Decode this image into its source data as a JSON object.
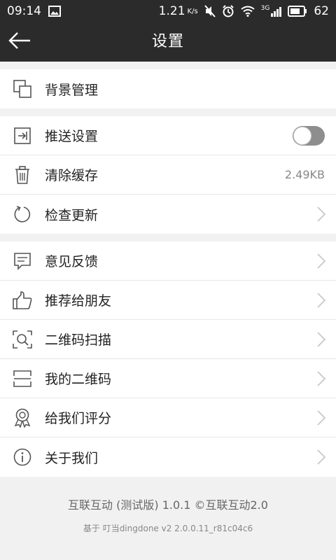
{
  "status_bar": {
    "time": "09:14",
    "speed": "1.21",
    "speed_unit": "K/s",
    "network": "3G",
    "battery": "62"
  },
  "app_bar": {
    "title": "设置",
    "back_icon": "arrow-left-icon"
  },
  "groups": [
    {
      "items": [
        {
          "label": "背景管理",
          "icon": "background-icon"
        }
      ]
    },
    {
      "items": [
        {
          "label": "推送设置",
          "icon": "push-icon",
          "toggle": "off"
        },
        {
          "label": "清除缓存",
          "icon": "trash-icon",
          "value": "2.49KB"
        },
        {
          "label": "检查更新",
          "icon": "refresh-icon"
        }
      ]
    },
    {
      "items": [
        {
          "label": "意见反馈",
          "icon": "feedback-icon"
        },
        {
          "label": "推荐给朋友",
          "icon": "thumbs-up-icon"
        },
        {
          "label": "二维码扫描",
          "icon": "scan-icon"
        },
        {
          "label": "我的二维码",
          "icon": "qrcode-icon"
        },
        {
          "label": "给我们评分",
          "icon": "award-icon"
        },
        {
          "label": "关于我们",
          "icon": "info-icon"
        }
      ]
    }
  ],
  "footer": {
    "line1": "互联互动 (测试版) 1.0.1 ©互联互动2.0",
    "line2": "基于 叮当dingdone v2 2.0.0.11_r81c04c6"
  },
  "colors": {
    "bar": "#2b2b2b",
    "toggle_off": "#8e8e8e",
    "background": "#f1f1f1"
  }
}
